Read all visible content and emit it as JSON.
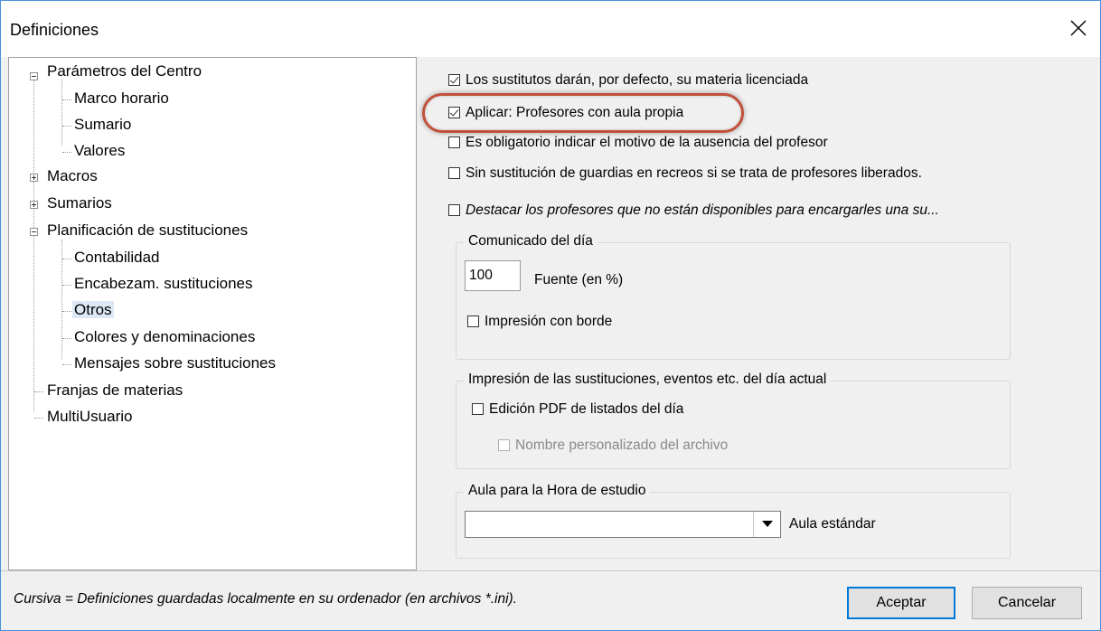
{
  "window": {
    "title": "Definiciones",
    "close_icon": "close-icon"
  },
  "tree": {
    "items": [
      {
        "label": "Parámetros del Centro",
        "expander": "minus"
      },
      {
        "label": "Marco horario"
      },
      {
        "label": "Sumario"
      },
      {
        "label": "Valores"
      },
      {
        "label": "Macros",
        "expander": "plus"
      },
      {
        "label": "Sumarios",
        "expander": "plus"
      },
      {
        "label": "Planificación de sustituciones",
        "expander": "minus"
      },
      {
        "label": "Contabilidad"
      },
      {
        "label": "Encabezam. sustituciones"
      },
      {
        "label": "Otros",
        "selected": true
      },
      {
        "label": "Colores y denominaciones"
      },
      {
        "label": "Mensajes sobre sustituciones"
      },
      {
        "label": "Franjas de materias"
      },
      {
        "label": "MultiUsuario"
      }
    ]
  },
  "options": {
    "sustitutos": {
      "label": "Los sustitutos darán, por defecto, su materia licenciada",
      "checked": true
    },
    "aula_propia": {
      "label": "Aplicar: Profesores con aula propia",
      "checked": true
    },
    "motivo": {
      "label": "Es obligatorio indicar el motivo de la ausencia del profesor",
      "checked": false
    },
    "recreos": {
      "label": "Sin sustitución de guardias en recreos si se trata de profesores liberados.",
      "checked": false
    },
    "destacar": {
      "label": "Destacar los profesores que no están disponibles para encargarles una su...",
      "checked": false
    }
  },
  "comunicado": {
    "legend": "Comunicado del día",
    "font_value": "100",
    "font_label": "Fuente (en %)",
    "borde": {
      "label": "Impresión con borde",
      "checked": false
    }
  },
  "impresion": {
    "legend": "Impresión de las sustituciones, eventos etc. del día actual",
    "pdf": {
      "label": "Edición PDF de listados del día",
      "checked": false
    },
    "nombre": {
      "label": "Nombre personalizado del archivo",
      "checked": false,
      "disabled": true
    }
  },
  "aula_estudio": {
    "legend": "Aula para la Hora de estudio",
    "selected_value": "",
    "side_label": "Aula estándar"
  },
  "footer": {
    "note": "Cursiva = Definiciones guardadas localmente en su ordenador (en archivos *.ini).",
    "ok_label": "Aceptar",
    "cancel_label": "Cancelar"
  },
  "colors": {
    "highlight_ring": "#c0503a",
    "selection": "#dde8f5",
    "default_button_border": "#0078d7"
  }
}
